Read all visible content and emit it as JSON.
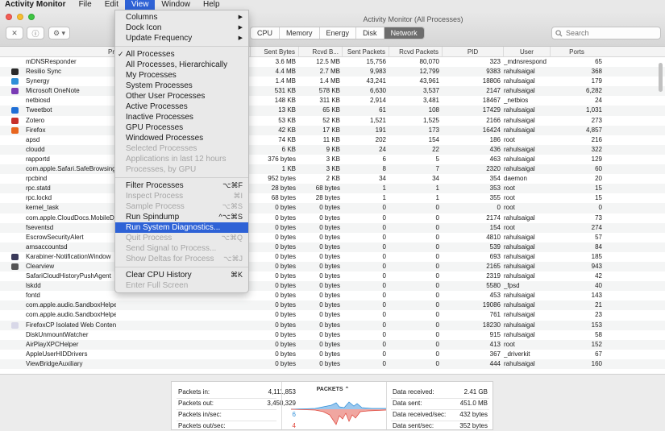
{
  "menubar": {
    "apple_icon": "apple-icon",
    "items": [
      {
        "label": "Activity Monitor",
        "bold": true
      },
      {
        "label": "File"
      },
      {
        "label": "Edit"
      },
      {
        "label": "View",
        "active": true
      },
      {
        "label": "Window"
      },
      {
        "label": "Help"
      }
    ]
  },
  "window": {
    "title": "Activity Monitor (All Processes)",
    "toolbar": {
      "close_glyph": "✕",
      "info_glyph": "ⓘ",
      "gear_glyph": "⚙ ▾",
      "tabs": [
        {
          "label": "CPU"
        },
        {
          "label": "Memory"
        },
        {
          "label": "Energy"
        },
        {
          "label": "Disk"
        },
        {
          "label": "Network",
          "selected": true
        }
      ],
      "search_placeholder": "Search",
      "search_value": ""
    }
  },
  "table": {
    "headers": {
      "process": "Pr",
      "sent_bytes": "Sent Bytes",
      "rcvd_bytes": "Rcvd B...",
      "sent_packets": "Sent Packets",
      "rcvd_packets": "Rcvd Packets",
      "pid": "PID",
      "user": "User",
      "ports": "Ports"
    },
    "rows": [
      {
        "name": "mDNSResponder",
        "icon": "",
        "sb": "3.6 MB",
        "rb": "12.5 MB",
        "sp": "15,756",
        "rp": "80,070",
        "pid": "323",
        "user": "_mdnsrespond",
        "ports": "65"
      },
      {
        "name": "Resilio Sync",
        "icon": "#2a2a2a",
        "sb": "4.4 MB",
        "rb": "2.7 MB",
        "sp": "9,983",
        "rp": "12,799",
        "pid": "9383",
        "user": "rahulsaigal",
        "ports": "368"
      },
      {
        "name": "Synergy",
        "icon": "#2f8fd8",
        "sb": "1.4 MB",
        "rb": "1.4 MB",
        "sp": "43,241",
        "rp": "43,961",
        "pid": "18806",
        "user": "rahulsaigal",
        "ports": "179"
      },
      {
        "name": "Microsoft OneNote",
        "icon": "#7a3bb5",
        "sb": "531 KB",
        "rb": "578 KB",
        "sp": "6,630",
        "rp": "3,537",
        "pid": "2147",
        "user": "rahulsaigal",
        "ports": "6,282"
      },
      {
        "name": "netbiosd",
        "icon": "",
        "sb": "148 KB",
        "rb": "311 KB",
        "sp": "2,914",
        "rp": "3,481",
        "pid": "18467",
        "user": "_netbios",
        "ports": "24"
      },
      {
        "name": "Tweetbot",
        "icon": "#1f6fd6",
        "sb": "13 KB",
        "rb": "65 KB",
        "sp": "61",
        "rp": "108",
        "pid": "17429",
        "user": "rahulsaigal",
        "ports": "1,031"
      },
      {
        "name": "Zotero",
        "icon": "#c7302a",
        "sb": "53 KB",
        "rb": "52 KB",
        "sp": "1,521",
        "rp": "1,525",
        "pid": "2166",
        "user": "rahulsaigal",
        "ports": "273"
      },
      {
        "name": "Firefox",
        "icon": "#e8661f",
        "sb": "42 KB",
        "rb": "17 KB",
        "sp": "191",
        "rp": "173",
        "pid": "16424",
        "user": "rahulsaigal",
        "ports": "4,857"
      },
      {
        "name": "apsd",
        "icon": "",
        "sb": "74 KB",
        "rb": "11 KB",
        "sp": "202",
        "rp": "154",
        "pid": "186",
        "user": "root",
        "ports": "216"
      },
      {
        "name": "cloudd",
        "icon": "",
        "sb": "6 KB",
        "rb": "9 KB",
        "sp": "24",
        "rp": "22",
        "pid": "436",
        "user": "rahulsaigal",
        "ports": "322"
      },
      {
        "name": "rapportd",
        "icon": "",
        "sb": "376 bytes",
        "rb": "3 KB",
        "sp": "6",
        "rp": "5",
        "pid": "463",
        "user": "rahulsaigal",
        "ports": "129"
      },
      {
        "name": "com.apple.Safari.SafeBrowsing",
        "icon": "",
        "sb": "1 KB",
        "rb": "3 KB",
        "sp": "8",
        "rp": "7",
        "pid": "2320",
        "user": "rahulsaigal",
        "ports": "60"
      },
      {
        "name": "rpcbind",
        "icon": "",
        "sb": "952 bytes",
        "rb": "2 KB",
        "sp": "34",
        "rp": "34",
        "pid": "354",
        "user": "daemon",
        "ports": "20"
      },
      {
        "name": "rpc.statd",
        "icon": "",
        "sb": "28 bytes",
        "rb": "68 bytes",
        "sp": "1",
        "rp": "1",
        "pid": "353",
        "user": "root",
        "ports": "15"
      },
      {
        "name": "rpc.lockd",
        "icon": "",
        "sb": "68 bytes",
        "rb": "28 bytes",
        "sp": "1",
        "rp": "1",
        "pid": "355",
        "user": "root",
        "ports": "15"
      },
      {
        "name": "kernel_task",
        "icon": "",
        "sb": "0 bytes",
        "rb": "0 bytes",
        "sp": "0",
        "rp": "0",
        "pid": "0",
        "user": "root",
        "ports": "0"
      },
      {
        "name": "com.apple.CloudDocs.MobileDocumentsFileProvider",
        "icon": "",
        "sb": "0 bytes",
        "rb": "0 bytes",
        "sp": "0",
        "rp": "0",
        "pid": "2174",
        "user": "rahulsaigal",
        "ports": "73"
      },
      {
        "name": "fseventsd",
        "icon": "",
        "sb": "0 bytes",
        "rb": "0 bytes",
        "sp": "0",
        "rp": "0",
        "pid": "154",
        "user": "root",
        "ports": "274"
      },
      {
        "name": "EscrowSecurityAlert",
        "icon": "",
        "sb": "0 bytes",
        "rb": "0 bytes",
        "sp": "0",
        "rp": "0",
        "pid": "4810",
        "user": "rahulsaigal",
        "ports": "57"
      },
      {
        "name": "amsaccountsd",
        "icon": "",
        "sb": "0 bytes",
        "rb": "0 bytes",
        "sp": "0",
        "rp": "0",
        "pid": "539",
        "user": "rahulsaigal",
        "ports": "84"
      },
      {
        "name": "Karabiner-NotificationWindow",
        "icon": "#3a3a5a",
        "sb": "0 bytes",
        "rb": "0 bytes",
        "sp": "0",
        "rp": "0",
        "pid": "693",
        "user": "rahulsaigal",
        "ports": "185"
      },
      {
        "name": "Clearview",
        "icon": "#555555",
        "sb": "0 bytes",
        "rb": "0 bytes",
        "sp": "0",
        "rp": "0",
        "pid": "2165",
        "user": "rahulsaigal",
        "ports": "943"
      },
      {
        "name": "SafariCloudHistoryPushAgent",
        "icon": "",
        "sb": "0 bytes",
        "rb": "0 bytes",
        "sp": "0",
        "rp": "0",
        "pid": "2319",
        "user": "rahulsaigal",
        "ports": "42"
      },
      {
        "name": "lskdd",
        "icon": "",
        "sb": "0 bytes",
        "rb": "0 bytes",
        "sp": "0",
        "rp": "0",
        "pid": "5580",
        "user": "_fpsd",
        "ports": "40"
      },
      {
        "name": "fontd",
        "icon": "",
        "sb": "0 bytes",
        "rb": "0 bytes",
        "sp": "0",
        "rp": "0",
        "pid": "453",
        "user": "rahulsaigal",
        "ports": "143"
      },
      {
        "name": "com.apple.audio.SandboxHelper",
        "icon": "",
        "sb": "0 bytes",
        "rb": "0 bytes",
        "sp": "0",
        "rp": "0",
        "pid": "19086",
        "user": "rahulsaigal",
        "ports": "21"
      },
      {
        "name": "com.apple.audio.SandboxHelper",
        "icon": "",
        "sb": "0 bytes",
        "rb": "0 bytes",
        "sp": "0",
        "rp": "0",
        "pid": "761",
        "user": "rahulsaigal",
        "ports": "23"
      },
      {
        "name": "FirefoxCP Isolated Web Content",
        "icon": "#d8d8e8",
        "sb": "0 bytes",
        "rb": "0 bytes",
        "sp": "0",
        "rp": "0",
        "pid": "18230",
        "user": "rahulsaigal",
        "ports": "153"
      },
      {
        "name": "DiskUnmountWatcher",
        "icon": "",
        "sb": "0 bytes",
        "rb": "0 bytes",
        "sp": "0",
        "rp": "0",
        "pid": "915",
        "user": "rahulsaigal",
        "ports": "58"
      },
      {
        "name": "AirPlayXPCHelper",
        "icon": "",
        "sb": "0 bytes",
        "rb": "0 bytes",
        "sp": "0",
        "rp": "0",
        "pid": "413",
        "user": "root",
        "ports": "152"
      },
      {
        "name": "AppleUserHIDDrivers",
        "icon": "",
        "sb": "0 bytes",
        "rb": "0 bytes",
        "sp": "0",
        "rp": "0",
        "pid": "367",
        "user": "_driverkit",
        "ports": "67"
      },
      {
        "name": "ViewBridgeAuxiliary",
        "icon": "",
        "sb": "0 bytes",
        "rb": "0 bytes",
        "sp": "0",
        "rp": "0",
        "pid": "444",
        "user": "rahulsaigal",
        "ports": "160"
      }
    ]
  },
  "summary": {
    "packets_in_label": "Packets in:",
    "packets_in": "4,111,853",
    "packets_out_label": "Packets out:",
    "packets_out": "3,450,329",
    "packets_in_sec_label": "Packets in/sec:",
    "packets_in_sec": "6",
    "packets_out_sec_label": "Packets out/sec:",
    "packets_out_sec": "4",
    "graph_title": "PACKETS",
    "data_received_label": "Data received:",
    "data_received": "2.41 GB",
    "data_sent_label": "Data sent:",
    "data_sent": "451.0 MB",
    "data_received_sec_label": "Data received/sec:",
    "data_received_sec": "432 bytes",
    "data_sent_sec_label": "Data sent/sec:",
    "data_sent_sec": "352 bytes",
    "in_color": "#2f8fd8",
    "out_color": "#e0453a"
  },
  "view_menu": {
    "items": [
      {
        "label": "Columns",
        "submenu": true
      },
      {
        "label": "Dock Icon",
        "submenu": true
      },
      {
        "label": "Update Frequency",
        "submenu": true
      },
      {
        "sep": true
      },
      {
        "label": "All Processes",
        "checked": true
      },
      {
        "label": "All Processes, Hierarchically"
      },
      {
        "label": "My Processes"
      },
      {
        "label": "System Processes"
      },
      {
        "label": "Other User Processes"
      },
      {
        "label": "Active Processes"
      },
      {
        "label": "Inactive Processes"
      },
      {
        "label": "GPU Processes"
      },
      {
        "label": "Windowed Processes"
      },
      {
        "label": "Selected Processes",
        "disabled": true
      },
      {
        "label": "Applications in last 12 hours",
        "disabled": true
      },
      {
        "label": "Processes, by GPU",
        "disabled": true
      },
      {
        "sep": true
      },
      {
        "label": "Filter Processes",
        "shortcut": "⌥⌘F"
      },
      {
        "label": "Inspect Process",
        "shortcut": "⌘I",
        "disabled": true
      },
      {
        "label": "Sample Process",
        "shortcut": "⌥⌘S",
        "disabled": true
      },
      {
        "label": "Run Spindump",
        "shortcut": "^⌥⌘S"
      },
      {
        "label": "Run System Diagnostics...",
        "highlighted": true
      },
      {
        "label": "Quit Process",
        "shortcut": "⌥⌘Q",
        "disabled": true
      },
      {
        "label": "Send Signal to Process...",
        "disabled": true
      },
      {
        "label": "Show Deltas for Process",
        "shortcut": "⌥⌘J",
        "disabled": true
      },
      {
        "sep": true
      },
      {
        "label": "Clear CPU History",
        "shortcut": "⌘K"
      },
      {
        "label": "Enter Full Screen",
        "disabled": true
      }
    ]
  }
}
